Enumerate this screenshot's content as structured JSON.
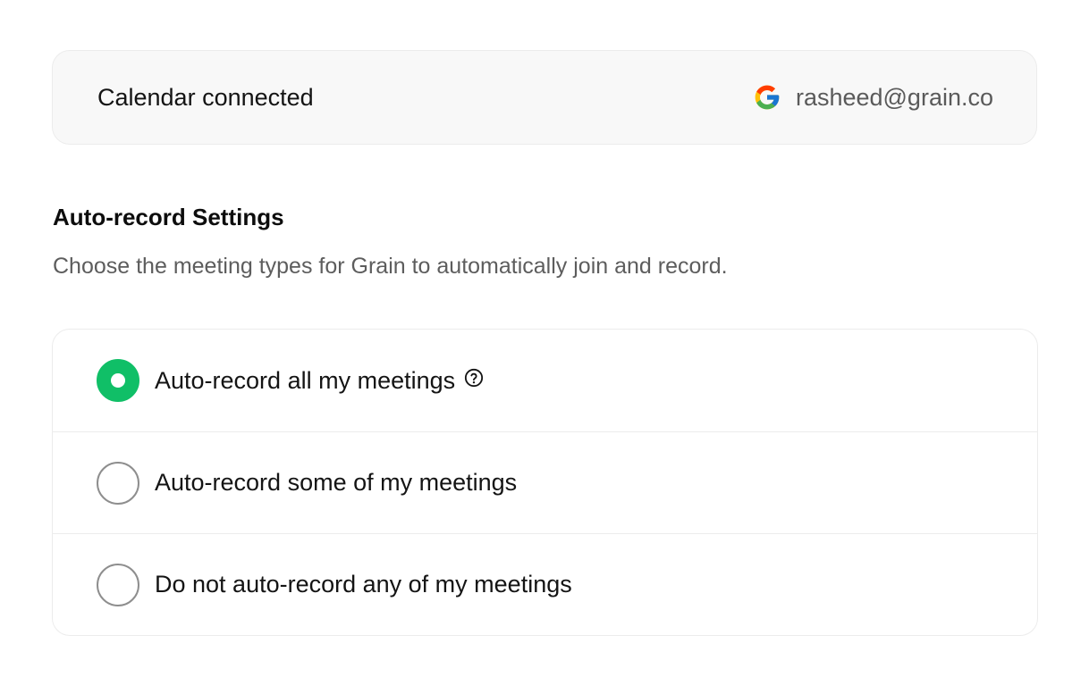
{
  "calendar": {
    "label": "Calendar connected",
    "provider_icon": "google-icon",
    "account_email": "rasheed@grain.co"
  },
  "auto_record": {
    "title": "Auto-record Settings",
    "description": "Choose the meeting types for Grain to automatically join and record.",
    "selected_index": 0,
    "options": [
      {
        "label": "Auto-record all my meetings",
        "selected": true,
        "help_icon": "help-circle-icon"
      },
      {
        "label": "Auto-record some of my meetings",
        "selected": false
      },
      {
        "label": "Do not auto-record any of my meetings",
        "selected": false
      }
    ]
  },
  "colors": {
    "accent": "#10bf67",
    "card_background": "#f8f8f8",
    "border": "#ececec",
    "muted_text": "#5d5d5d"
  }
}
